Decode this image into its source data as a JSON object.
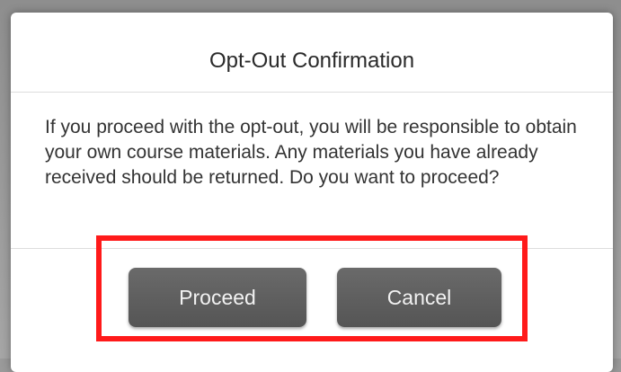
{
  "dialog": {
    "title": "Opt-Out Confirmation",
    "message": "If you proceed with the opt-out, you will be responsible to obtain your own course materials. Any materials you have already received should be returned. Do you want to proceed?",
    "buttons": {
      "proceed_label": "Proceed",
      "cancel_label": "Cancel"
    }
  },
  "colors": {
    "highlight": "#ff1a1a",
    "button_bg": "#5f5f5f"
  }
}
